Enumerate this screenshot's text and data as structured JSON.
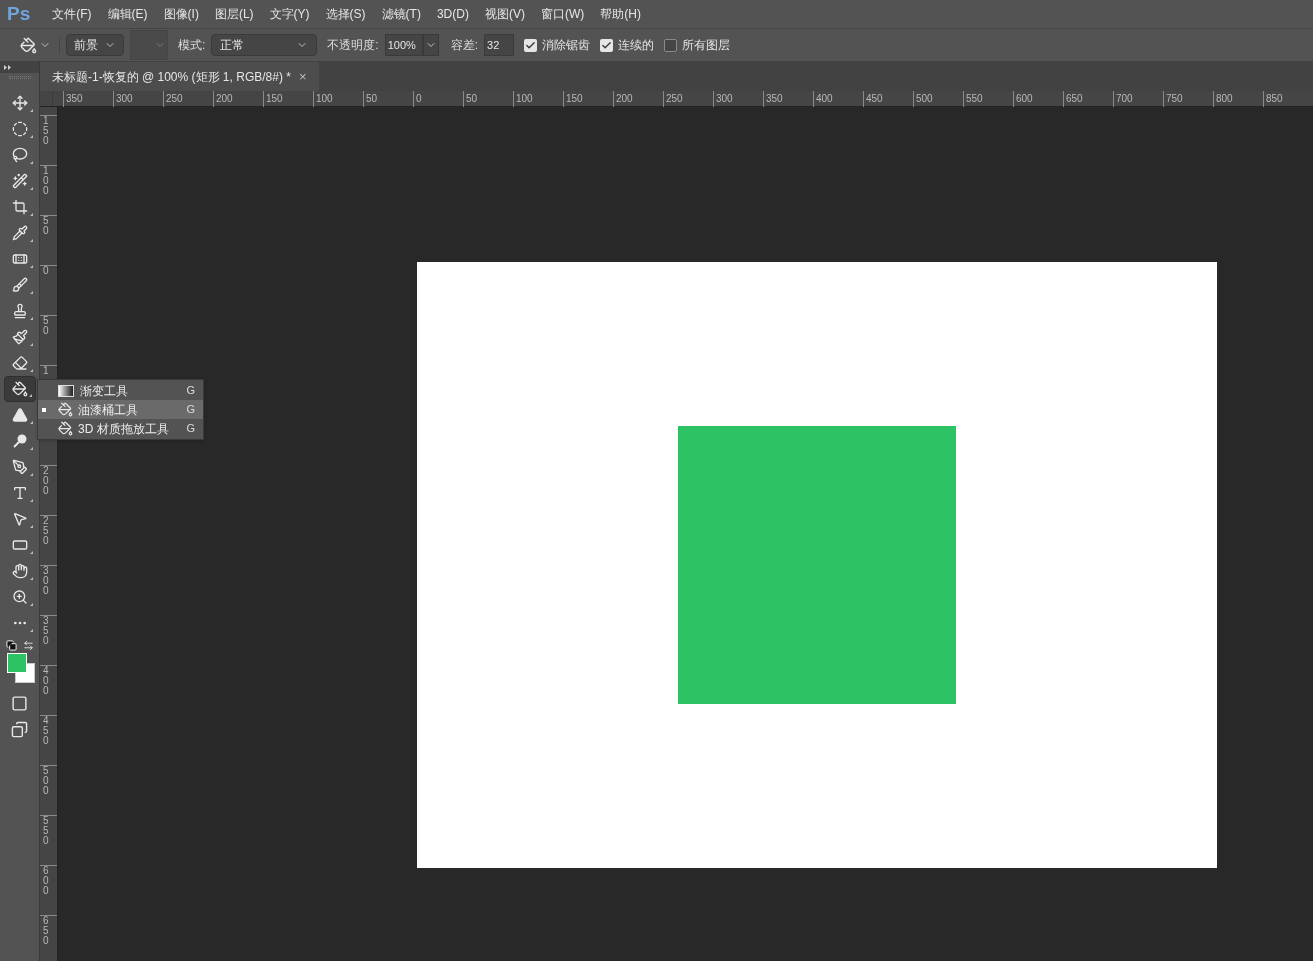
{
  "menu_bar": {
    "logo": "Ps",
    "items": [
      "文件(F)",
      "编辑(E)",
      "图像(I)",
      "图层(L)",
      "文字(Y)",
      "选择(S)",
      "滤镜(T)",
      "3D(D)",
      "视图(V)",
      "窗口(W)",
      "帮助(H)"
    ]
  },
  "options_bar": {
    "fill_source": "前景",
    "mode_label": "模式:",
    "mode": "正常",
    "opacity_label": "不透明度:",
    "opacity": "100%",
    "tolerance_label": "容差:",
    "tolerance": "32",
    "checkboxes": [
      {
        "label": "消除锯齿",
        "checked": true
      },
      {
        "label": "连续的",
        "checked": true
      },
      {
        "label": "所有图层",
        "checked": false
      }
    ]
  },
  "document_tab": {
    "title": "未标题-1-恢复的 @ 100% (矩形 1, RGB/8#) *",
    "close": "×"
  },
  "top_ruler": [
    "350",
    "300",
    "250",
    "200",
    "150",
    "100",
    "50",
    "0",
    "50",
    "100",
    "150",
    "200",
    "250",
    "300",
    "350",
    "400",
    "450",
    "500",
    "550",
    "600",
    "650",
    "700",
    "750",
    "800",
    "850"
  ],
  "left_ruler_upper": [
    "150",
    "100",
    "50",
    "0",
    "50",
    "1"
  ],
  "left_ruler_lower": [
    "200",
    "250",
    "300",
    "350",
    "400",
    "450",
    "500",
    "550",
    "600",
    "650"
  ],
  "tools": [
    {
      "selected": false
    },
    {
      "selected": false
    },
    {
      "selected": false
    },
    {
      "selected": false
    },
    {
      "selected": false
    },
    {
      "selected": false
    },
    {
      "selected": false
    },
    {
      "selected": false
    },
    {
      "selected": false
    },
    {
      "selected": false
    },
    {
      "selected": false
    },
    {
      "selected": true
    },
    {
      "selected": false
    },
    {
      "selected": false
    },
    {
      "selected": false
    },
    {
      "selected": false
    },
    {
      "selected": false
    },
    {
      "selected": false
    },
    {
      "selected": false
    },
    {
      "selected": false
    },
    {
      "selected": false
    }
  ],
  "tool_flyout": [
    {
      "label": "渐变工具",
      "shortcut": "G",
      "selected": false
    },
    {
      "label": "油漆桶工具",
      "shortcut": "G",
      "selected": true
    },
    {
      "label": "3D 材质拖放工具",
      "shortcut": "G",
      "selected": false
    }
  ]
}
